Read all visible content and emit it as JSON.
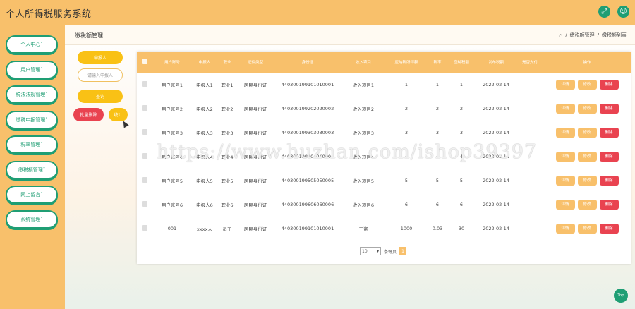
{
  "app": {
    "title": "个人所得税服务系统"
  },
  "topbar": {
    "icons": [
      "expand-icon",
      "user-icon"
    ]
  },
  "sidebar": {
    "items": [
      {
        "label": "个人中心"
      },
      {
        "label": "用户管理"
      },
      {
        "label": "税法法规管理"
      },
      {
        "label": "缴税申报管理"
      },
      {
        "label": "税率管理"
      },
      {
        "label": "缴税额管理"
      },
      {
        "label": "网上留言"
      },
      {
        "label": "系统管理"
      }
    ],
    "caret": "˅"
  },
  "page": {
    "heading": "缴税额管理",
    "breadcrumb": [
      "缴税额管理",
      "缴税额列表"
    ],
    "separator": "/"
  },
  "filters": {
    "declarant_button": "申报人",
    "declarant_placeholder": "请输入申报人",
    "search_button": "查询",
    "batch_delete_button": "批量删除",
    "stats_button": "统计"
  },
  "table": {
    "columns": [
      "用户账号",
      "申报人",
      "职业",
      "证件类型",
      "身份证",
      "收入项目",
      "应纳税所得额",
      "税率",
      "应纳税额",
      "发布税额",
      "是否支付",
      "操作"
    ],
    "rows": [
      [
        "用户账号1",
        "申报人1",
        "职业1",
        "居民身份证",
        "440300199101010001",
        "收入项目1",
        "1",
        "1",
        "1",
        "2022-02-14",
        ""
      ],
      [
        "用户账号2",
        "申报人2",
        "职业2",
        "居民身份证",
        "440300199202020002",
        "收入项目2",
        "2",
        "2",
        "2",
        "2022-02-14",
        ""
      ],
      [
        "用户账号3",
        "申报人3",
        "职业3",
        "居民身份证",
        "440300199303030003",
        "收入项目3",
        "3",
        "3",
        "3",
        "2022-02-14",
        ""
      ],
      [
        "用户账号4",
        "申报人4",
        "职业4",
        "居民身份证",
        "440300199404040004",
        "收入项目4",
        "4",
        "4",
        "4",
        "2022-02-14",
        ""
      ],
      [
        "用户账号5",
        "申报人5",
        "职业5",
        "居民身份证",
        "440300199505050005",
        "收入项目5",
        "5",
        "5",
        "5",
        "2022-02-14",
        ""
      ],
      [
        "用户账号6",
        "申报人6",
        "职业6",
        "居民身份证",
        "440300199606060006",
        "收入项目6",
        "6",
        "6",
        "6",
        "2022-02-14",
        ""
      ],
      [
        "001",
        "xxxx人",
        "员工",
        "居民身份证",
        "440300199101010001",
        "工资",
        "1000",
        "0.03",
        "30",
        "2022-02-14",
        ""
      ]
    ],
    "actions": {
      "view": "详情",
      "edit": "修改",
      "delete": "删除"
    }
  },
  "pagination": {
    "page_size": "10",
    "per_page_label": "条每页",
    "current_page": "1"
  },
  "watermark": "https://www.huzhan.com/ishop39397",
  "top_button": "Top",
  "colors": {
    "primary": "#f8c06b",
    "accent": "#1f9e74",
    "danger": "#e94350",
    "yellow": "#f9c115"
  }
}
